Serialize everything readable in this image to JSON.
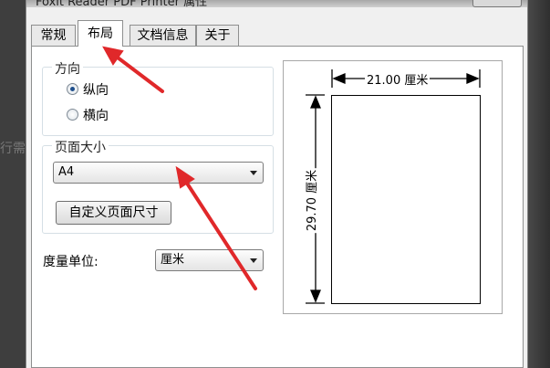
{
  "background_text": "行需",
  "window": {
    "title": "Foxit Reader PDF Printer 属性"
  },
  "tabs": [
    {
      "label": "常规",
      "active": false
    },
    {
      "label": "布局",
      "active": true
    },
    {
      "label": "文档信息",
      "active": false
    },
    {
      "label": "关于",
      "active": false
    }
  ],
  "orientation": {
    "label": "方向",
    "options": [
      {
        "label": "纵向",
        "checked": true
      },
      {
        "label": "横向",
        "checked": false
      }
    ]
  },
  "page_size": {
    "label": "页面大小",
    "selected": "A4",
    "custom_button": "自定义页面尺寸"
  },
  "unit": {
    "label": "度量单位:",
    "selected": "厘米"
  },
  "preview": {
    "width_label": "21.00 厘米",
    "height_label": "29.70 厘米"
  },
  "colors": {
    "annotation": "#e0282a",
    "selected_radio": "#1f4f8c"
  },
  "icons": {
    "dropdown": "chevron-down-icon",
    "annotation": "red-arrow-icon"
  }
}
